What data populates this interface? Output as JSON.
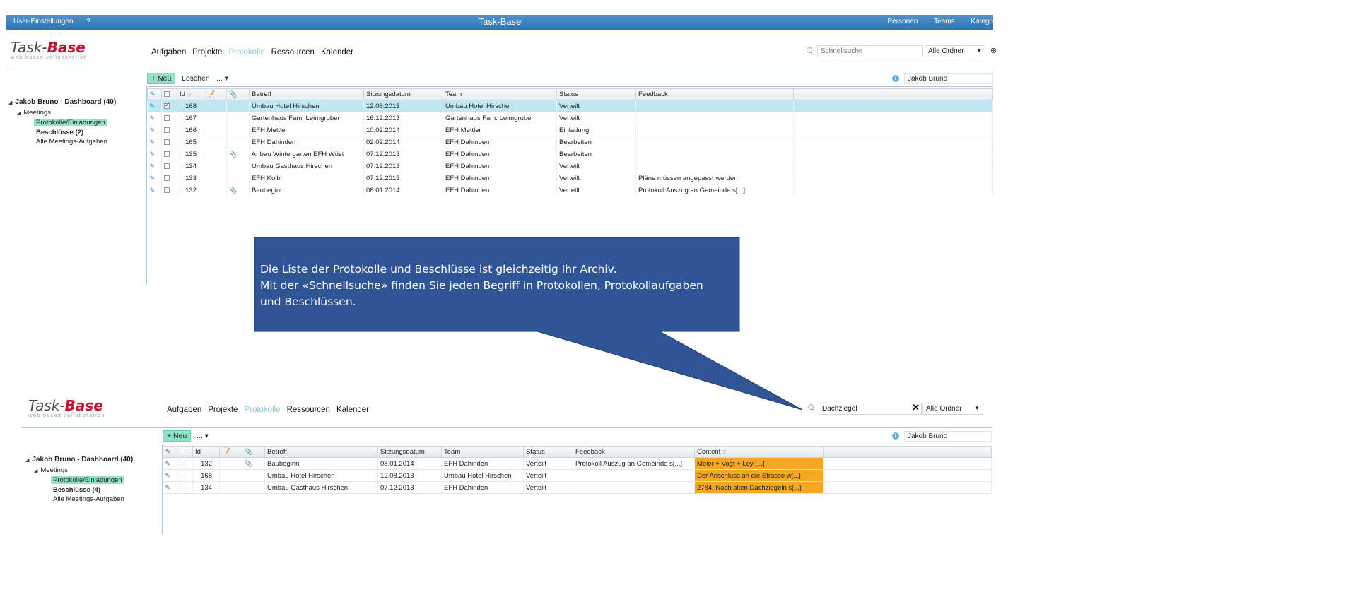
{
  "topbar": {
    "left_items": [
      "User-Einstellungen",
      "?"
    ],
    "title": "Task-Base",
    "right_items": [
      "Personen",
      "Teams",
      "Katego"
    ]
  },
  "logo": {
    "word1": "Task-",
    "word2": "Base",
    "tagline": "web based collaboration"
  },
  "nav": {
    "items": [
      "Aufgaben",
      "Projekte",
      "Protokolle",
      "Ressourcen",
      "Kalender"
    ],
    "active": "Protokolle"
  },
  "panel1": {
    "search_placeholder": "Schnellsuche",
    "folder": "Alle Ordner",
    "toolbar": {
      "new": "+ Neu",
      "delete": "Löschen",
      "more": "... ▾"
    },
    "user": "Jakob Bruno",
    "tree": {
      "root": "Jakob Bruno - Dashboard (40)",
      "meetings": "Meetings",
      "selected": "Protokolle/Einladungen",
      "decisions": "Beschlüsse (2)",
      "all_tasks": "Alle Meetings-Aufgaben"
    },
    "columns": [
      "Id",
      "Betreff",
      "Sitzungsdatum",
      "Team",
      "Status",
      "Feedback"
    ],
    "rows": [
      {
        "id": "168",
        "checked": true,
        "clip": false,
        "betreff": "Umbau Hotel Hirschen",
        "datum": "12.08.2013",
        "team": "Umbau Hotel Hirschen",
        "status": "Verteilt",
        "feedback": ""
      },
      {
        "id": "167",
        "checked": false,
        "clip": false,
        "betreff": "Gartenhaus Fam. Leimgruber",
        "datum": "16.12.2013",
        "team": "Gartenhaus Fam. Leimgruber",
        "status": "Verteilt",
        "feedback": ""
      },
      {
        "id": "166",
        "checked": false,
        "clip": false,
        "betreff": "EFH Mettler",
        "datum": "10.02.2014",
        "team": "EFH Mettler",
        "status": "Einladung",
        "feedback": ""
      },
      {
        "id": "165",
        "checked": false,
        "clip": false,
        "betreff": "EFH Dahinden",
        "datum": "02.02.2014",
        "team": "EFH Dahinden",
        "status": "Bearbeiten",
        "feedback": ""
      },
      {
        "id": "135",
        "checked": false,
        "clip": true,
        "betreff": "Anbau Wintergarten EFH Wüst",
        "datum": "07.12.2013",
        "team": "EFH Dahinden",
        "status": "Bearbeiten",
        "feedback": ""
      },
      {
        "id": "134",
        "checked": false,
        "clip": false,
        "betreff": "Umbau Gasthaus Hirschen",
        "datum": "07.12.2013",
        "team": "EFH Dahinden",
        "status": "Verteilt",
        "feedback": ""
      },
      {
        "id": "133",
        "checked": false,
        "clip": false,
        "betreff": "EFH Kolb",
        "datum": "07.12.2013",
        "team": "EFH Dahinden",
        "status": "Verteilt",
        "feedback": "Pläne müssen angepasst werden"
      },
      {
        "id": "132",
        "checked": false,
        "clip": true,
        "betreff": "Baubeginn",
        "datum": "08.01.2014",
        "team": "EFH Dahinden",
        "status": "Verteilt",
        "feedback": "Protokoll Auszug an Gemeinde s[...]"
      }
    ]
  },
  "callout": {
    "lines": [
      "Die Liste der Protokolle und Beschlüsse ist gleichzeitig Ihr Archiv.",
      "Mit der «Schnellsuche» finden Sie jeden Begriff in Protokollen, Protokollaufgaben",
      "und Beschlüssen."
    ],
    "color": "#2f5597"
  },
  "panel2": {
    "search_value": "Dachziegel",
    "folder": "Alle Ordner",
    "toolbar": {
      "new": "+ Neu",
      "more": "... ▾"
    },
    "user": "Jakob Bruno",
    "tree": {
      "root": "Jakob Bruno - Dashboard (40)",
      "meetings": "Meetings",
      "selected": "Protokolle/Einladungen",
      "decisions": "Beschlüsse (4)",
      "all_tasks": "Alle Meetings-Aufgaben"
    },
    "columns": [
      "Id",
      "Betreff",
      "Sitzungsdatum",
      "Team",
      "Status",
      "Feedback",
      "Content"
    ],
    "rows": [
      {
        "id": "132",
        "clip": true,
        "betreff": "Baubeginn",
        "datum": "08.01.2014",
        "team": "EFH Dahinden",
        "status": "Verteilt",
        "feedback": "Protokoll Auszug an Gemeinde s[...]",
        "content": "Meier + Vogt + Ley          [...]"
      },
      {
        "id": "168",
        "clip": false,
        "betreff": "Umbau Hotel Hirschen",
        "datum": "12.08.2013",
        "team": "Umbau Hotel Hirschen",
        "status": "Verteilt",
        "feedback": "",
        "content": "Der Anschluss an die Strasse w[...]"
      },
      {
        "id": "134",
        "clip": false,
        "betreff": "Umbau Gasthaus Hirschen",
        "datum": "07.12.2013",
        "team": "EFH Dahinden",
        "status": "Verteilt",
        "feedback": "",
        "content": "2784: Nach alten Dachziegeln s[...]"
      }
    ]
  }
}
